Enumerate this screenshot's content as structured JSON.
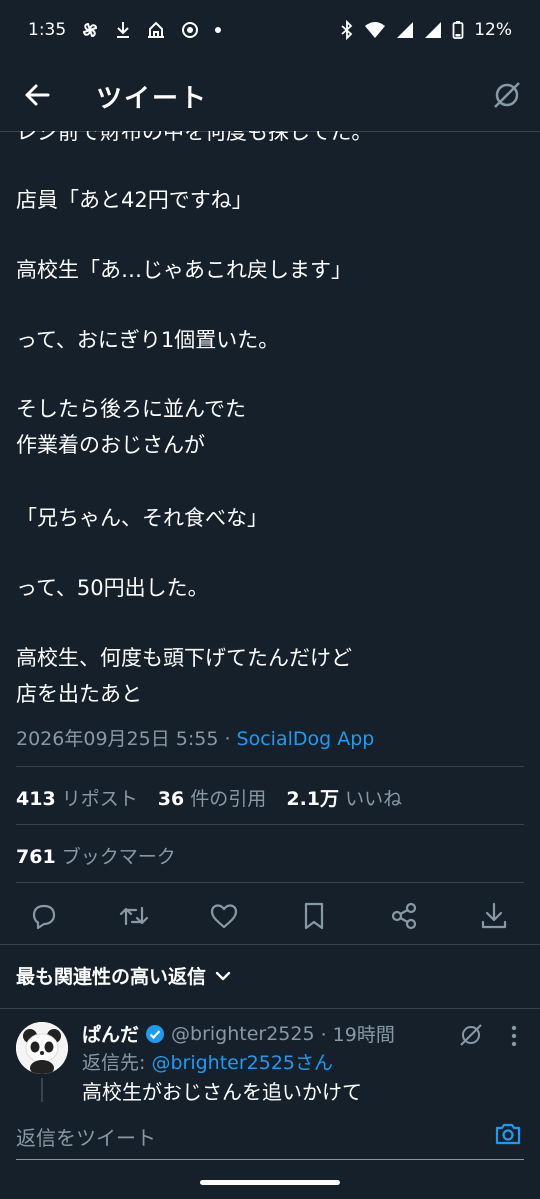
{
  "status_bar": {
    "time": "1:35",
    "battery": "12%"
  },
  "header": {
    "title": "ツイート"
  },
  "tweet": {
    "lines": [
      "レジ前で財布の中を何度も探してた。",
      "店員「あと42円ですね」",
      "高校生「あ…じゃあこれ戻します」",
      "って、おにぎり1個置いた。",
      "そしたら後ろに並んでた",
      "作業着のおじさんが",
      "「兄ちゃん、それ食べな」",
      "って、50円出した。",
      "高校生、何度も頭下げてたんだけど",
      "店を出たあと"
    ],
    "timestamp": "2026年09月25日 5:55",
    "separator": " · ",
    "via": "SocialDog App"
  },
  "stats": {
    "retweets_count": "413",
    "retweets_label": "リポスト",
    "quotes_count": "36",
    "quotes_label": "件の引用",
    "likes_count": "2.1万",
    "likes_label": "いいね",
    "bookmarks_count": "761",
    "bookmarks_label": "ブックマーク"
  },
  "actions": [
    "reply-icon",
    "retweet-icon",
    "like-icon",
    "bookmark-icon",
    "share-icon",
    "download-icon"
  ],
  "sort": {
    "label": "最も関連性の高い返信"
  },
  "reply": {
    "name": "ぱんだ",
    "handle": "@brighter2525",
    "time": "· 19時間",
    "reply_to_prefix": "返信先: ",
    "reply_to_link": "@brighter2525さん",
    "text": "高校生がおじさんを追いかけて"
  },
  "composer": {
    "placeholder": "返信をツイート"
  },
  "colors": {
    "background": "#15202b",
    "accent": "#1d9bf0",
    "secondary_text": "#8899a6",
    "divider": "#38444d"
  }
}
